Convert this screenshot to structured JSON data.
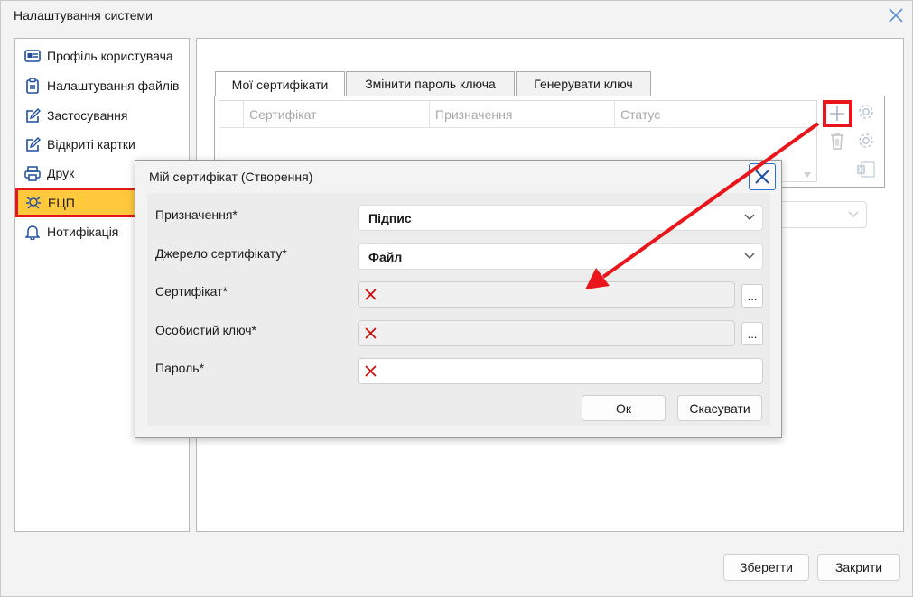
{
  "window": {
    "title": "Налаштування системи"
  },
  "sidebar": {
    "items": [
      {
        "label": "Профіль користувача",
        "icon": "id-card-icon"
      },
      {
        "label": "Налаштування файлів",
        "icon": "clipboard-icon"
      },
      {
        "label": "Застосування",
        "icon": "edit-icon"
      },
      {
        "label": "Відкриті картки",
        "icon": "edit-icon"
      },
      {
        "label": "Друк",
        "icon": "printer-icon"
      },
      {
        "label": "ЕЦП",
        "icon": "signature-icon",
        "active": true
      },
      {
        "label": "Нотифікація",
        "icon": "bell-icon"
      }
    ]
  },
  "tabs": [
    {
      "label": "Мої сертифікати",
      "active": true
    },
    {
      "label": "Змінити пароль ключа"
    },
    {
      "label": "Генерувати ключ"
    }
  ],
  "grid": {
    "columns": [
      "Сертифікат",
      "Призначення",
      "Статус"
    ],
    "rows": []
  },
  "footer": {
    "save_label": "Зберегти",
    "close_label": "Закрити"
  },
  "dialog": {
    "title": "Мій сертифікат (Створення)",
    "fields": {
      "purpose": {
        "label": "Призначення*",
        "value": "Підпис"
      },
      "source": {
        "label": "Джерело сертифікату*",
        "value": "Файл"
      },
      "certificate": {
        "label": "Сертифікат*",
        "value": ""
      },
      "private_key": {
        "label": "Особистий ключ*",
        "value": ""
      },
      "password": {
        "label": "Пароль*",
        "value": ""
      }
    },
    "browse_label": "...",
    "ok_label": "Ок",
    "cancel_label": "Скасувати"
  },
  "colors": {
    "highlight_red": "#e8161b",
    "active_yellow": "#ffc83d",
    "accent_blue": "#2a6fc9"
  }
}
